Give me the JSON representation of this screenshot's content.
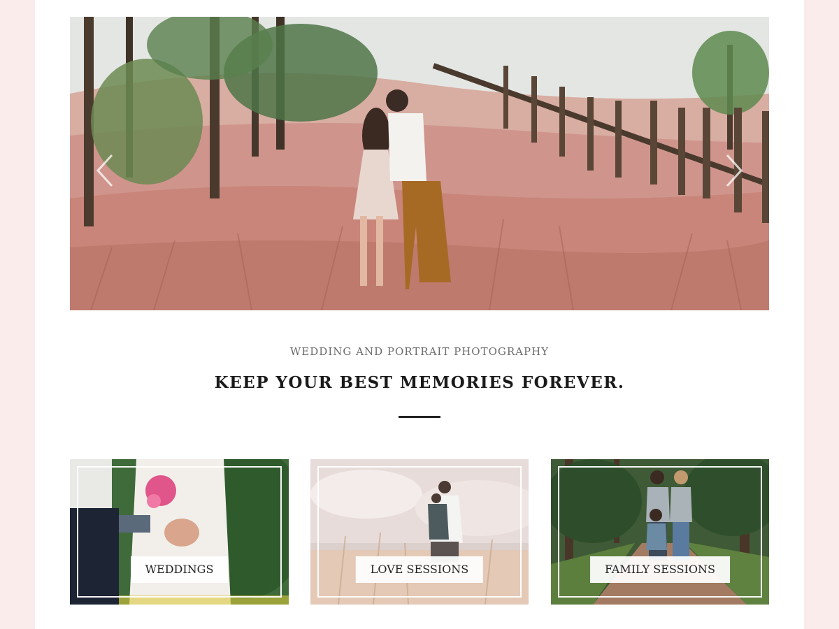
{
  "hero": {
    "prev_arrow": "chevron-left-icon",
    "next_arrow": "chevron-right-icon"
  },
  "intro": {
    "tagline": "WEDDING AND PORTRAIT PHOTOGRAPHY",
    "headline": "KEEP YOUR BEST MEMORIES FOREVER."
  },
  "services": [
    {
      "label": "WEDDINGS"
    },
    {
      "label": "LOVE SESSIONS"
    },
    {
      "label": "FAMILY SESSIONS"
    }
  ],
  "colors": {
    "page_background": "#f9ecea",
    "content_background": "#ffffff",
    "heading_text": "#1a1a1a",
    "tagline_text": "#6b6b6b",
    "divider": "#222222"
  }
}
